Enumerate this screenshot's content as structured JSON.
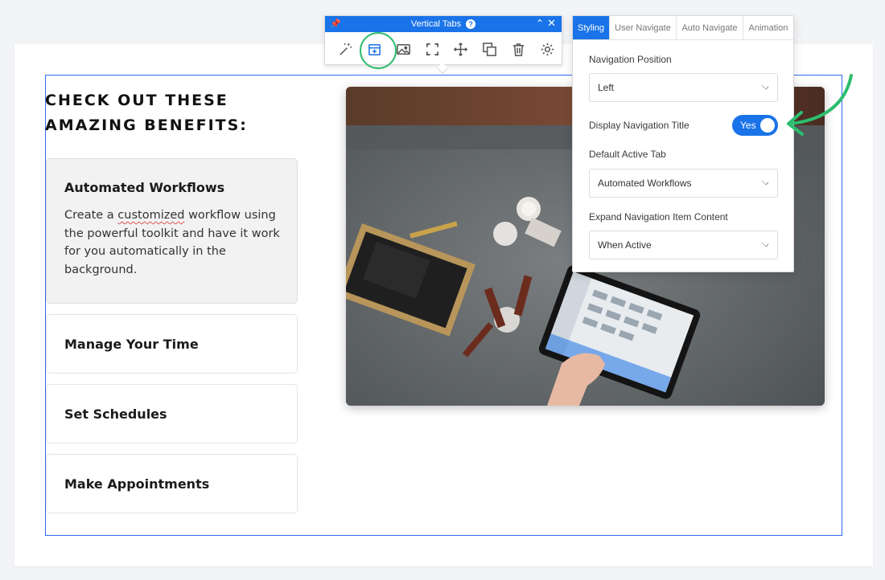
{
  "page": {
    "heading": "CHECK OUT THESE AMAZING BENEFITS:",
    "tabs": [
      {
        "title": "Automated Workflows",
        "body_before": "Create a ",
        "body_underlined": "customized",
        "body_after": " workflow using the powerful toolkit and have it work for you automatically in the background."
      },
      {
        "title": "Manage Your Time"
      },
      {
        "title": "Set Schedules"
      },
      {
        "title": "Make Appointments"
      }
    ]
  },
  "toolbar": {
    "title": "Vertical Tabs",
    "tools": [
      "magic-wand-icon",
      "add-tab-icon",
      "image-icon",
      "expand-icon",
      "move-icon",
      "duplicate-icon",
      "delete-icon",
      "settings-icon"
    ]
  },
  "panel": {
    "tabs": [
      "Styling",
      "User Navigate",
      "Auto Navigate",
      "Animation"
    ],
    "active_tab": "Styling",
    "navigation_position": {
      "label": "Navigation Position",
      "value": "Left"
    },
    "display_navigation_title": {
      "label": "Display Navigation Title",
      "value": "Yes"
    },
    "default_active_tab": {
      "label": "Default Active Tab",
      "value": "Automated Workflows"
    },
    "expand_content": {
      "label": "Expand Navigation Item Content",
      "value": "When Active"
    }
  },
  "colors": {
    "accent": "#1a73e8",
    "highlight": "#2dbd6e",
    "outline": "#2f6bed"
  }
}
